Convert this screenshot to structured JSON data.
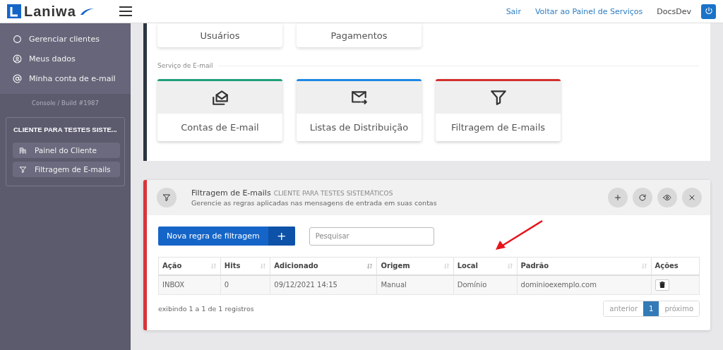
{
  "brand": {
    "name": "Laniwa"
  },
  "topbar": {
    "links": [
      "Sair",
      "Voltar ao Painel de Serviços"
    ],
    "user": "DocsDev"
  },
  "sidebar": {
    "items": [
      {
        "label": "Gerenciar clientes",
        "kind": "circle"
      },
      {
        "label": "Meus dados",
        "kind": "user"
      },
      {
        "label": "Minha conta de e-mail",
        "kind": "at"
      }
    ],
    "build": "Console / Build #1987",
    "client": {
      "title": "CLIENTE PARA TESTES SISTE...",
      "items": [
        {
          "label": "Painel do Cliente",
          "kind": "building"
        },
        {
          "label": "Filtragem de E-mails",
          "kind": "filter"
        }
      ]
    }
  },
  "services": {
    "top_tiles": [
      "Usuários",
      "Pagamentos"
    ],
    "section_title": "Serviço de E-mail",
    "tiles": [
      {
        "label": "Contas de E-mail",
        "kind": "inbox",
        "color": "#1fa07a"
      },
      {
        "label": "Listas de Distribuição",
        "kind": "forward",
        "color": "#1e88e5"
      },
      {
        "label": "Filtragem de E-mails",
        "kind": "filter",
        "color": "#d32f2f"
      }
    ]
  },
  "panel": {
    "title": "Filtragem de E-mails",
    "client": "CLIENTE PARA TESTES SISTEMÁTICOS",
    "subtitle": "Gerencie as regras aplicadas nas mensagens de entrada em suas contas",
    "tools": [
      {
        "kind": "add"
      },
      {
        "kind": "refresh"
      },
      {
        "kind": "view"
      },
      {
        "kind": "close"
      }
    ],
    "new_button": "Nova regra de filtragem",
    "new_button_icon": "+",
    "search": {
      "placeholder": "Pesquisar"
    },
    "table": {
      "columns": [
        {
          "label": "Ação",
          "sortable": true,
          "sorted": false
        },
        {
          "label": "Hits",
          "sortable": true,
          "sorted": false
        },
        {
          "label": "Adicionado",
          "sortable": true,
          "sorted": true
        },
        {
          "label": "Origem",
          "sortable": true,
          "sorted": false
        },
        {
          "label": "Local",
          "sortable": true,
          "sorted": false
        },
        {
          "label": "Padrão",
          "sortable": true,
          "sorted": false
        },
        {
          "label": "Ações",
          "sortable": false
        }
      ],
      "rows": [
        [
          "INBOX",
          "0",
          "09/12/2021 14:15",
          "Manual",
          "Domínio",
          "dominioexemplo.com"
        ]
      ]
    },
    "info": "exibindo 1 a 1 de 1 registros",
    "pagination": {
      "prev": "anterior",
      "pages": [
        {
          "label": "1",
          "selected": true
        }
      ],
      "next": "próximo"
    }
  }
}
